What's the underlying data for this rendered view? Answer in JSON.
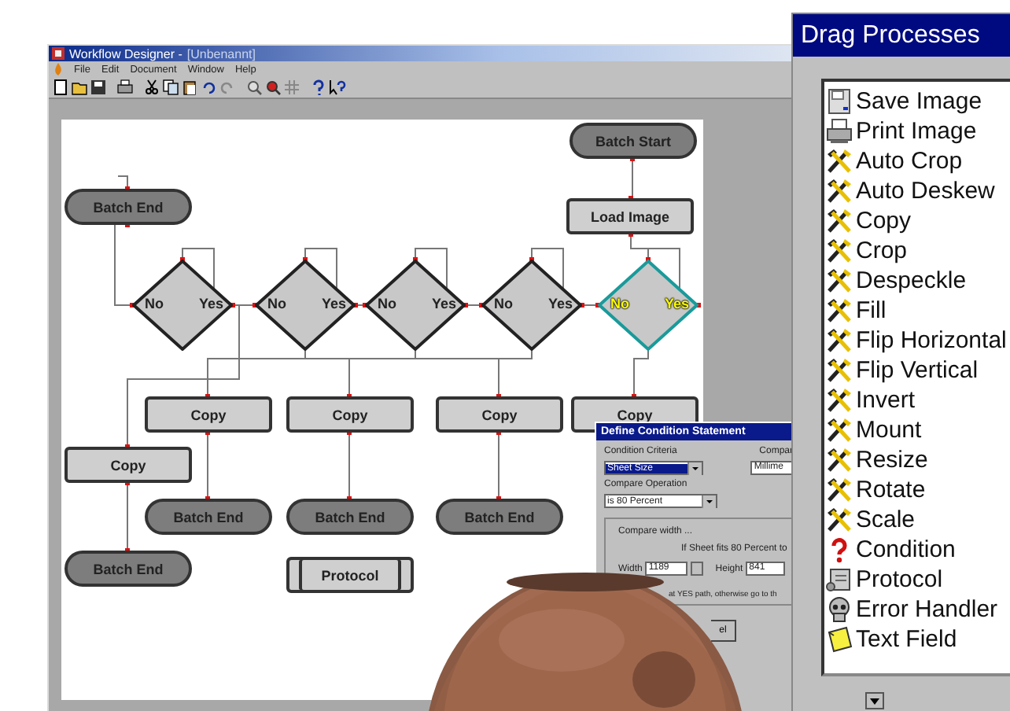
{
  "window": {
    "title": "Workflow Designer - ",
    "document": "[Unbenannt]"
  },
  "menu": [
    "File",
    "Edit",
    "Document",
    "Window",
    "Help"
  ],
  "flowchart": {
    "nodes": [
      {
        "kind": "terminal",
        "label": "Batch Start"
      },
      {
        "kind": "process",
        "label": "Load Image"
      },
      {
        "kind": "terminal",
        "label": "Batch End"
      },
      {
        "kind": "decision",
        "no": "No",
        "yes": "Yes",
        "selected": false
      },
      {
        "kind": "decision",
        "no": "No",
        "yes": "Yes",
        "selected": false
      },
      {
        "kind": "decision",
        "no": "No",
        "yes": "Yes",
        "selected": false
      },
      {
        "kind": "decision",
        "no": "No",
        "yes": "Yes",
        "selected": false
      },
      {
        "kind": "decision",
        "no": "No",
        "yes": "Yes",
        "selected": true
      },
      {
        "kind": "process",
        "label": "Copy"
      },
      {
        "kind": "process",
        "label": "Copy"
      },
      {
        "kind": "process",
        "label": "Copy"
      },
      {
        "kind": "process",
        "label": "Copy"
      },
      {
        "kind": "process",
        "label": "Copy"
      },
      {
        "kind": "terminal",
        "label": "Batch End"
      },
      {
        "kind": "terminal",
        "label": "Batch End"
      },
      {
        "kind": "terminal",
        "label": "Batch End"
      },
      {
        "kind": "terminal",
        "label": "Batch End"
      },
      {
        "kind": "protocol",
        "label": "Protocol"
      }
    ]
  },
  "dialog": {
    "title": "Define Condition Statement",
    "criteria_label": "Condition Criteria",
    "criteria_value": "Sheet Size",
    "compare_label": "Compar",
    "compare_value": "Millime",
    "operation_label": "Compare Operation",
    "operation_value": "is 80 Percent",
    "group_label": "Compare width ...",
    "group_text": "If Sheet fits 80 Percent to",
    "width_label": "Width",
    "width_value": "1189",
    "height_label": "Height",
    "height_value": "841",
    "path_text": "at YES path, otherwise go to th",
    "button": "el"
  },
  "palette": {
    "title": "Drag Processes",
    "items": [
      {
        "kind": "save",
        "label": "Save Image"
      },
      {
        "kind": "print",
        "label": "Print Image"
      },
      {
        "kind": "tool",
        "label": "Auto Crop"
      },
      {
        "kind": "tool",
        "label": "Auto Deskew"
      },
      {
        "kind": "tool",
        "label": "Copy"
      },
      {
        "kind": "tool",
        "label": "Crop"
      },
      {
        "kind": "tool",
        "label": "Despeckle"
      },
      {
        "kind": "tool",
        "label": "Fill"
      },
      {
        "kind": "tool",
        "label": "Flip Horizontal"
      },
      {
        "kind": "tool",
        "label": "Flip Vertical"
      },
      {
        "kind": "tool",
        "label": "Invert"
      },
      {
        "kind": "tool",
        "label": "Mount"
      },
      {
        "kind": "tool",
        "label": "Resize"
      },
      {
        "kind": "tool",
        "label": "Rotate"
      },
      {
        "kind": "tool",
        "label": "Scale"
      },
      {
        "kind": "condition",
        "label": "Condition"
      },
      {
        "kind": "protocol",
        "label": "Protocol"
      },
      {
        "kind": "error",
        "label": "Error Handler"
      },
      {
        "kind": "text",
        "label": "Text Field"
      }
    ]
  }
}
